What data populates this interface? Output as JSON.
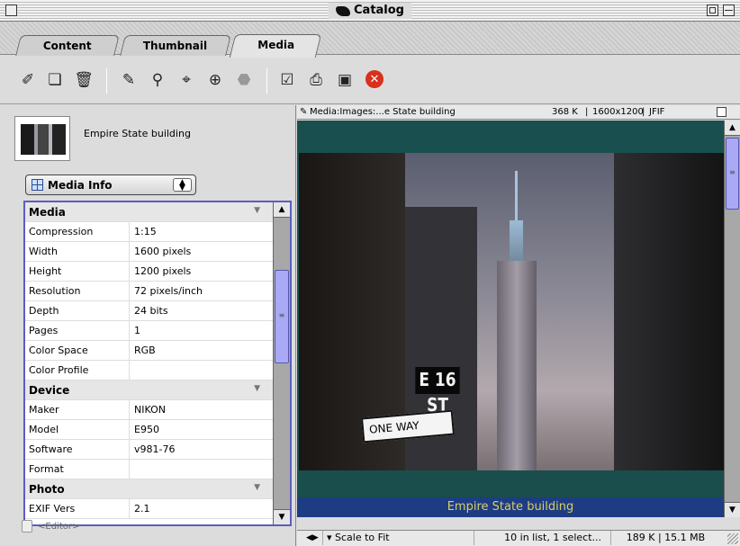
{
  "window": {
    "title": "Catalog"
  },
  "tabs": [
    {
      "label": "Content"
    },
    {
      "label": "Thumbnail"
    },
    {
      "label": "Media"
    }
  ],
  "toolbar": {
    "icons": [
      "eyedropper-icon",
      "folder-icon",
      "trash-icon",
      "annotate-icon",
      "search-icon",
      "cursor-icon",
      "target-icon",
      "apply-icon",
      "checklist-icon",
      "print-icon",
      "slideshow-icon",
      "stop-icon"
    ]
  },
  "left": {
    "media_name": "Empire State building",
    "popup_label": "Media Info",
    "sections": [
      {
        "title": "Media",
        "rows": [
          {
            "k": "Compression",
            "v": "1:15"
          },
          {
            "k": "Width",
            "v": "1600 pixels"
          },
          {
            "k": "Height",
            "v": "1200 pixels"
          },
          {
            "k": "Resolution",
            "v": "72 pixels/inch"
          },
          {
            "k": "Depth",
            "v": "24 bits"
          },
          {
            "k": "Pages",
            "v": "1"
          },
          {
            "k": "Color Space",
            "v": "RGB"
          },
          {
            "k": "Color Profile",
            "v": ""
          }
        ]
      },
      {
        "title": "Device",
        "rows": [
          {
            "k": "Maker",
            "v": "NIKON"
          },
          {
            "k": "Model",
            "v": "E950"
          },
          {
            "k": "Software",
            "v": "v981-76"
          },
          {
            "k": "Format",
            "v": ""
          }
        ]
      },
      {
        "title": "Photo",
        "rows": [
          {
            "k": "EXIF Vers",
            "v": "2.1"
          }
        ]
      }
    ],
    "editor_label": "<Editor>"
  },
  "viewer": {
    "path": "Media:Images:...e State building",
    "size": "368 K",
    "dimensions": "1600x1200",
    "format": "JFIF",
    "sign_street": "E 16 ST",
    "sign_oneway": "ONE WAY",
    "caption": "Empire State building"
  },
  "status": {
    "scale": "Scale to Fit",
    "count": "10 in list, 1 select...",
    "memory": "189 K | 15.1 MB"
  }
}
